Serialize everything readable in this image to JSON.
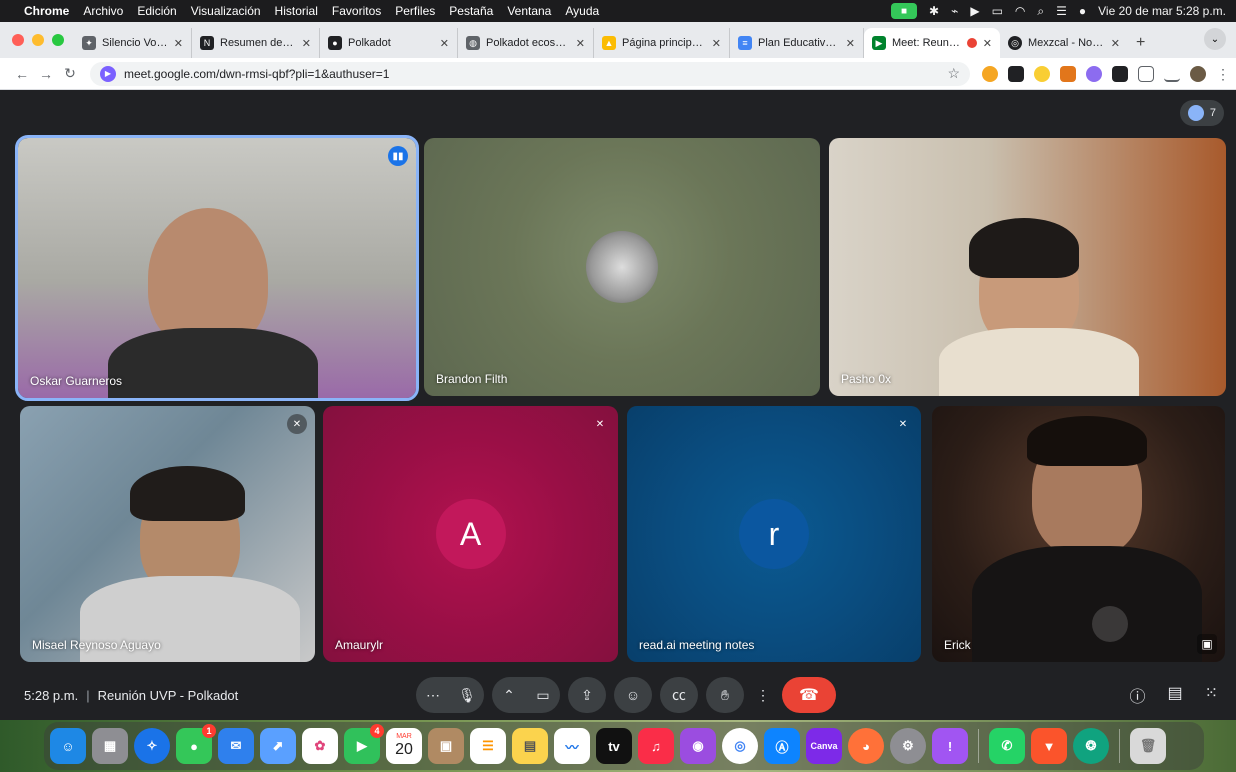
{
  "menubar": {
    "app_name": "Chrome",
    "menus": [
      "Archivo",
      "Edición",
      "Visualización",
      "Historial",
      "Favoritos",
      "Perfiles",
      "Pestaña",
      "Ventana",
      "Ayuda"
    ],
    "clock": "Vie 20 de mar 5:28 p.m."
  },
  "tabs": [
    {
      "label": "Silencio Voice AI",
      "favicon_color": "#5f6368",
      "icon": "sparkle-icon"
    },
    {
      "label": "Resumen de Polkad",
      "favicon_color": "#202124",
      "icon": "notion-icon"
    },
    {
      "label": "Polkadot",
      "favicon_color": "#202124",
      "icon": "polkadot-icon"
    },
    {
      "label": "Polkadot ecosystem",
      "favicon_color": "#5f6368",
      "icon": "globe-icon"
    },
    {
      "label": "Página principal - G",
      "favicon_color": "#fbbc04",
      "icon": "drive-icon"
    },
    {
      "label": "Plan Educativo by P",
      "favicon_color": "#4285f4",
      "icon": "docs-icon"
    },
    {
      "label": "Meet: Reunión U",
      "favicon_color": "#00832d",
      "icon": "meet-icon",
      "active": true
    },
    {
      "label": "Mexzcal - Noteboo",
      "favicon_color": "#202124",
      "icon": "notebooklm-icon"
    }
  ],
  "address": {
    "url": "meet.google.com/dwn-rmsi-qbf?pli=1&authuser=1"
  },
  "meet": {
    "participant_count": "7",
    "tiles": [
      {
        "name": "Oskar Guarneros",
        "state": "speaking",
        "video": true
      },
      {
        "name": "Brandon Filth",
        "state": "none",
        "video": false
      },
      {
        "name": "Pasho 0x",
        "state": "none",
        "video": true
      },
      {
        "name": "Misael Reynoso Aguayo",
        "state": "muted",
        "video": true
      },
      {
        "name": "Amaurylr",
        "state": "muted",
        "video": false,
        "avatar_letter": "A",
        "avatar_color": "#c2185b"
      },
      {
        "name": "read.ai meeting notes",
        "state": "muted",
        "video": false,
        "avatar_letter": "r",
        "avatar_color": "#0b57a0"
      },
      {
        "name": "Erick",
        "state": "none",
        "video": true
      }
    ],
    "time": "5:28 p.m.",
    "separator": "|",
    "meeting_title": "Reunión UVP - Polkadot"
  },
  "dock": {
    "calendar_month": "MAR",
    "calendar_day": "20",
    "facetime_badge": "4",
    "messages_badge": "1",
    "apps": [
      "finder",
      "launchpad",
      "safari",
      "messages",
      "mail",
      "maps",
      "photos",
      "facetime",
      "calendar",
      "contacts",
      "reminders",
      "notes",
      "freeform",
      "tv",
      "music",
      "podcasts",
      "chrome",
      "app-store",
      "canva",
      "firefox",
      "system-settings",
      "feedback",
      "whatsapp",
      "brave",
      "chatgpt",
      "trash"
    ]
  }
}
